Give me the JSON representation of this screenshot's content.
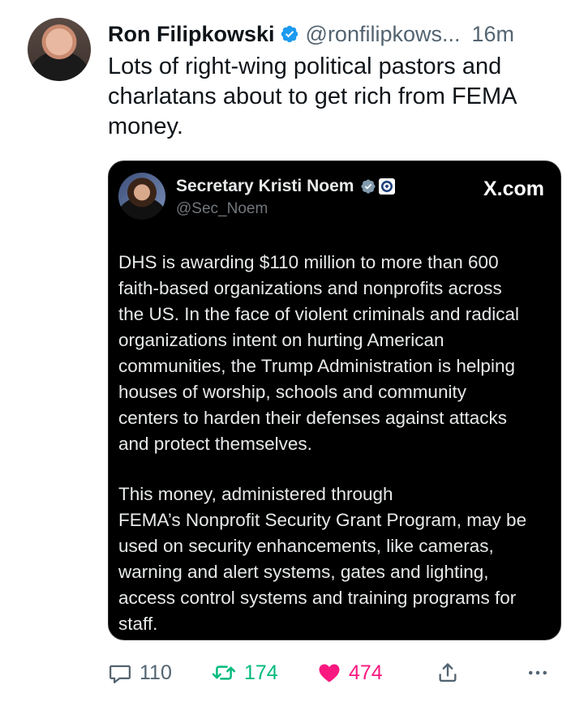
{
  "tweet": {
    "author_name": "Ron Filipkowski",
    "handle": "@ronfilipkows...",
    "time": "16m",
    "text": "Lots of right-wing political pastors and charlatans about to get rich from FEMA money."
  },
  "quoted": {
    "author_name": "Secretary Kristi Noem",
    "handle": "@Sec_Noem",
    "source": "X.com",
    "paragraph1": "DHS is awarding $110 million to more than 600\nfaith-based organizations and nonprofits across\nthe US. In the face of violent criminals and radical\norganizations intent on hurting American\ncommunities, the Trump Administration is helping\nhouses of worship, schools and community\ncenters to harden their defenses against attacks\nand protect themselves.",
    "paragraph2": "This money, administered through\nFEMA’s Nonprofit Security Grant Program, may be\nused on security enhancements, like cameras,\nwarning and alert systems, gates and lighting,\naccess control systems and training programs for\nstaff."
  },
  "actions": {
    "replies": "110",
    "reposts": "174",
    "likes": "474"
  },
  "icons": {
    "verified": "blue-verified-icon",
    "grey_verified": "grey-verified-icon",
    "dhs_seal": "dhs-seal-icon",
    "reply": "reply-icon",
    "repost": "repost-icon",
    "like": "heart-icon",
    "share": "share-icon",
    "more": "more-icon"
  },
  "colors": {
    "accent_blue": "#1d9bf0",
    "repost_green": "#00ba7c",
    "like_pink": "#f91880",
    "muted": "#536471"
  }
}
